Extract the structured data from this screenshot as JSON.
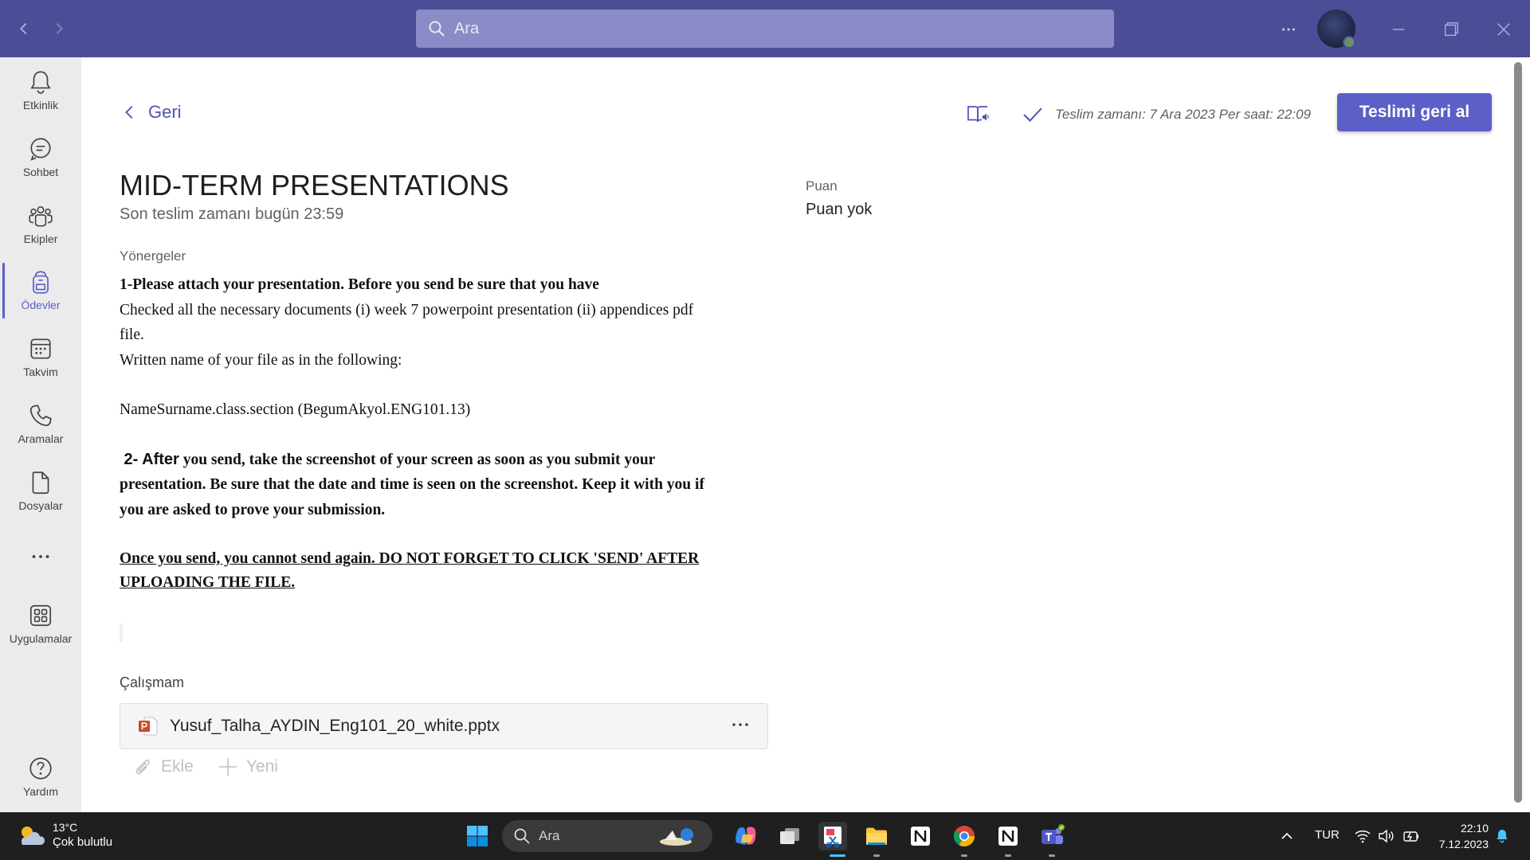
{
  "titlebar": {
    "search_placeholder": "Ara"
  },
  "rail": {
    "items": [
      {
        "label": "Etkinlik",
        "icon": "bell-icon"
      },
      {
        "label": "Sohbet",
        "icon": "chat-icon"
      },
      {
        "label": "Ekipler",
        "icon": "teams-icon"
      },
      {
        "label": "Ödevler",
        "icon": "backpack-icon",
        "active": true
      },
      {
        "label": "Takvim",
        "icon": "calendar-icon"
      },
      {
        "label": "Aramalar",
        "icon": "phone-icon"
      },
      {
        "label": "Dosyalar",
        "icon": "file-icon"
      },
      {
        "label": "Uygulamalar",
        "icon": "apps-icon"
      }
    ],
    "help_label": "Yardım"
  },
  "header": {
    "back_label": "Geri",
    "submitted_text": "Teslim zamanı: 7 Ara 2023 Per saat: 22:09",
    "undo_button": "Teslimi geri al"
  },
  "assignment": {
    "title": "MID-TERM PRESENTATIONS",
    "due": "Son teslim zamanı bugün 23:59",
    "instructions_label": "Yönergeler",
    "instructions": {
      "line1": "1-Please attach your presentation. Before you send be sure that you have",
      "line2": "Checked all the necessary documents (i) week 7 powerpoint presentation (ii) appendices pdf",
      "line3": "file.",
      "line4": "Written name of your file as in the following:",
      "line5": "NameSurname.class.section (BegumAkyol.ENG101.13)",
      "step2_lead": " 2- After",
      "step2_rest": " you send, take the screenshot of your screen as soon as you submit your",
      "step2_line2": "presentation. Be sure that the date and time is seen on the screenshot. Keep it with you if",
      "step2_line3": "you are asked to prove your submission.",
      "warning_line1": "Once you send, you cannot send again. DO NOT FORGET TO CLICK 'SEND' AFTER",
      "warning_line2": "UPLOADING THE FILE."
    },
    "work_label": "Çalışmam",
    "file_name": "Yusuf_Talha_AYDIN_Eng101_20_white.pptx",
    "attach_label": "Ekle",
    "new_label": "Yeni",
    "points_label": "Puan",
    "points_value": "Puan yok"
  },
  "taskbar": {
    "weather_temp": "13°C",
    "weather_cond": "Çok bulutlu",
    "search_placeholder": "Ara",
    "language": "TUR",
    "time": "22:10",
    "date": "7.12.2023"
  },
  "colors": {
    "titlebar": "#4b4e97",
    "accent": "#5b5fc7",
    "rail": "#ebebeb",
    "taskbar": "#1f1f1f"
  }
}
